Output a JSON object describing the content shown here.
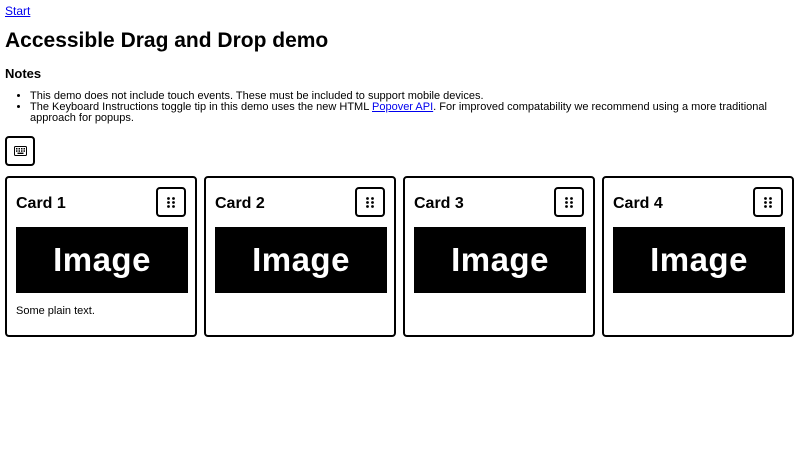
{
  "skip_link": "Start",
  "page_title": "Accessible Drag and Drop demo",
  "notes": {
    "heading": "Notes",
    "item1": "This demo does not include touch events. These must be included to support mobile devices.",
    "item2_before": "The Keyboard Instructions toggle tip in this demo uses the new HTML ",
    "item2_link": "Popover API",
    "item2_after": ". For improved compatability we recommend using a more traditional approach for popups."
  },
  "keyboard_button_icon": "keyboard-icon",
  "cards": [
    {
      "title": "Card 1",
      "image_label": "Image",
      "text": "Some plain text.",
      "handle_icon": "drag-handle-icon"
    },
    {
      "title": "Card 2",
      "image_label": "Image",
      "text": "",
      "handle_icon": "drag-handle-icon"
    },
    {
      "title": "Card 3",
      "image_label": "Image",
      "text": "",
      "handle_icon": "drag-handle-icon"
    },
    {
      "title": "Card 4",
      "image_label": "Image",
      "text": "",
      "handle_icon": "drag-handle-icon"
    }
  ],
  "colors": {
    "link": "#0000ee",
    "border": "#000000",
    "image_bg": "#000000",
    "image_text": "#ffffff"
  }
}
